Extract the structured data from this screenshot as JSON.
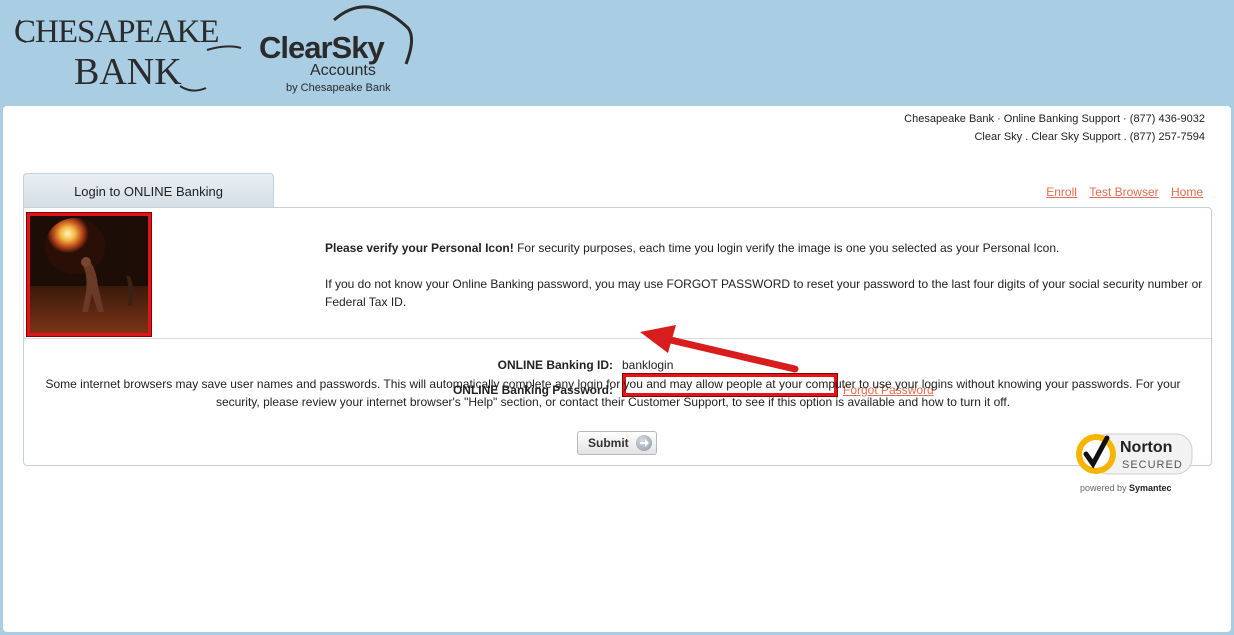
{
  "header": {
    "bank_logo": "CHESAPEAKE BANK",
    "product_logo": {
      "name": "ClearSky",
      "sub": "Accounts",
      "byline": "by Chesapeake Bank"
    }
  },
  "support": {
    "line1": "Chesapeake Bank · Online Banking Support · (877) 436-9032",
    "line2": "Clear Sky . Clear Sky Support . (877) 257-7594"
  },
  "tab": {
    "label": "Login to ONLINE Banking"
  },
  "links": {
    "enroll": "Enroll",
    "test_browser": "Test Browser",
    "home": "Home"
  },
  "verify": {
    "bold": "Please verify your Personal Icon!",
    "text": " For security purposes, each time you login verify the image is one you selected as your Personal Icon.",
    "para2": "If you do not know your Online Banking password, you may use FORGOT PASSWORD to reset your password to the last four digits of your social security number or Federal Tax ID."
  },
  "form": {
    "id_label": "ONLINE Banking ID:",
    "id_value": "banklogin",
    "password_label": "ONLINE Banking Password:",
    "password_value": "",
    "forgot_label": "Forgot Password",
    "submit_label": "Submit"
  },
  "disclaimer": "Some internet browsers may save user names and passwords. This will automatically complete any login for you and may allow people at your computer to use your logins without knowing your passwords. For your security, please review your internet browser's \"Help\" section, or contact their Customer Support, to see if this option is available and how to turn it off.",
  "norton": {
    "brand": "Norton",
    "secured": "SECURED",
    "powered_prefix": "powered by ",
    "powered_brand": "Symantec"
  },
  "colors": {
    "link": "#e06d4f",
    "highlight": "#e1141a",
    "background": "#a9cde3"
  },
  "icons": {
    "personal_icon": "fire-breather-image",
    "submit_icon": "arrow-right-circle-icon"
  }
}
